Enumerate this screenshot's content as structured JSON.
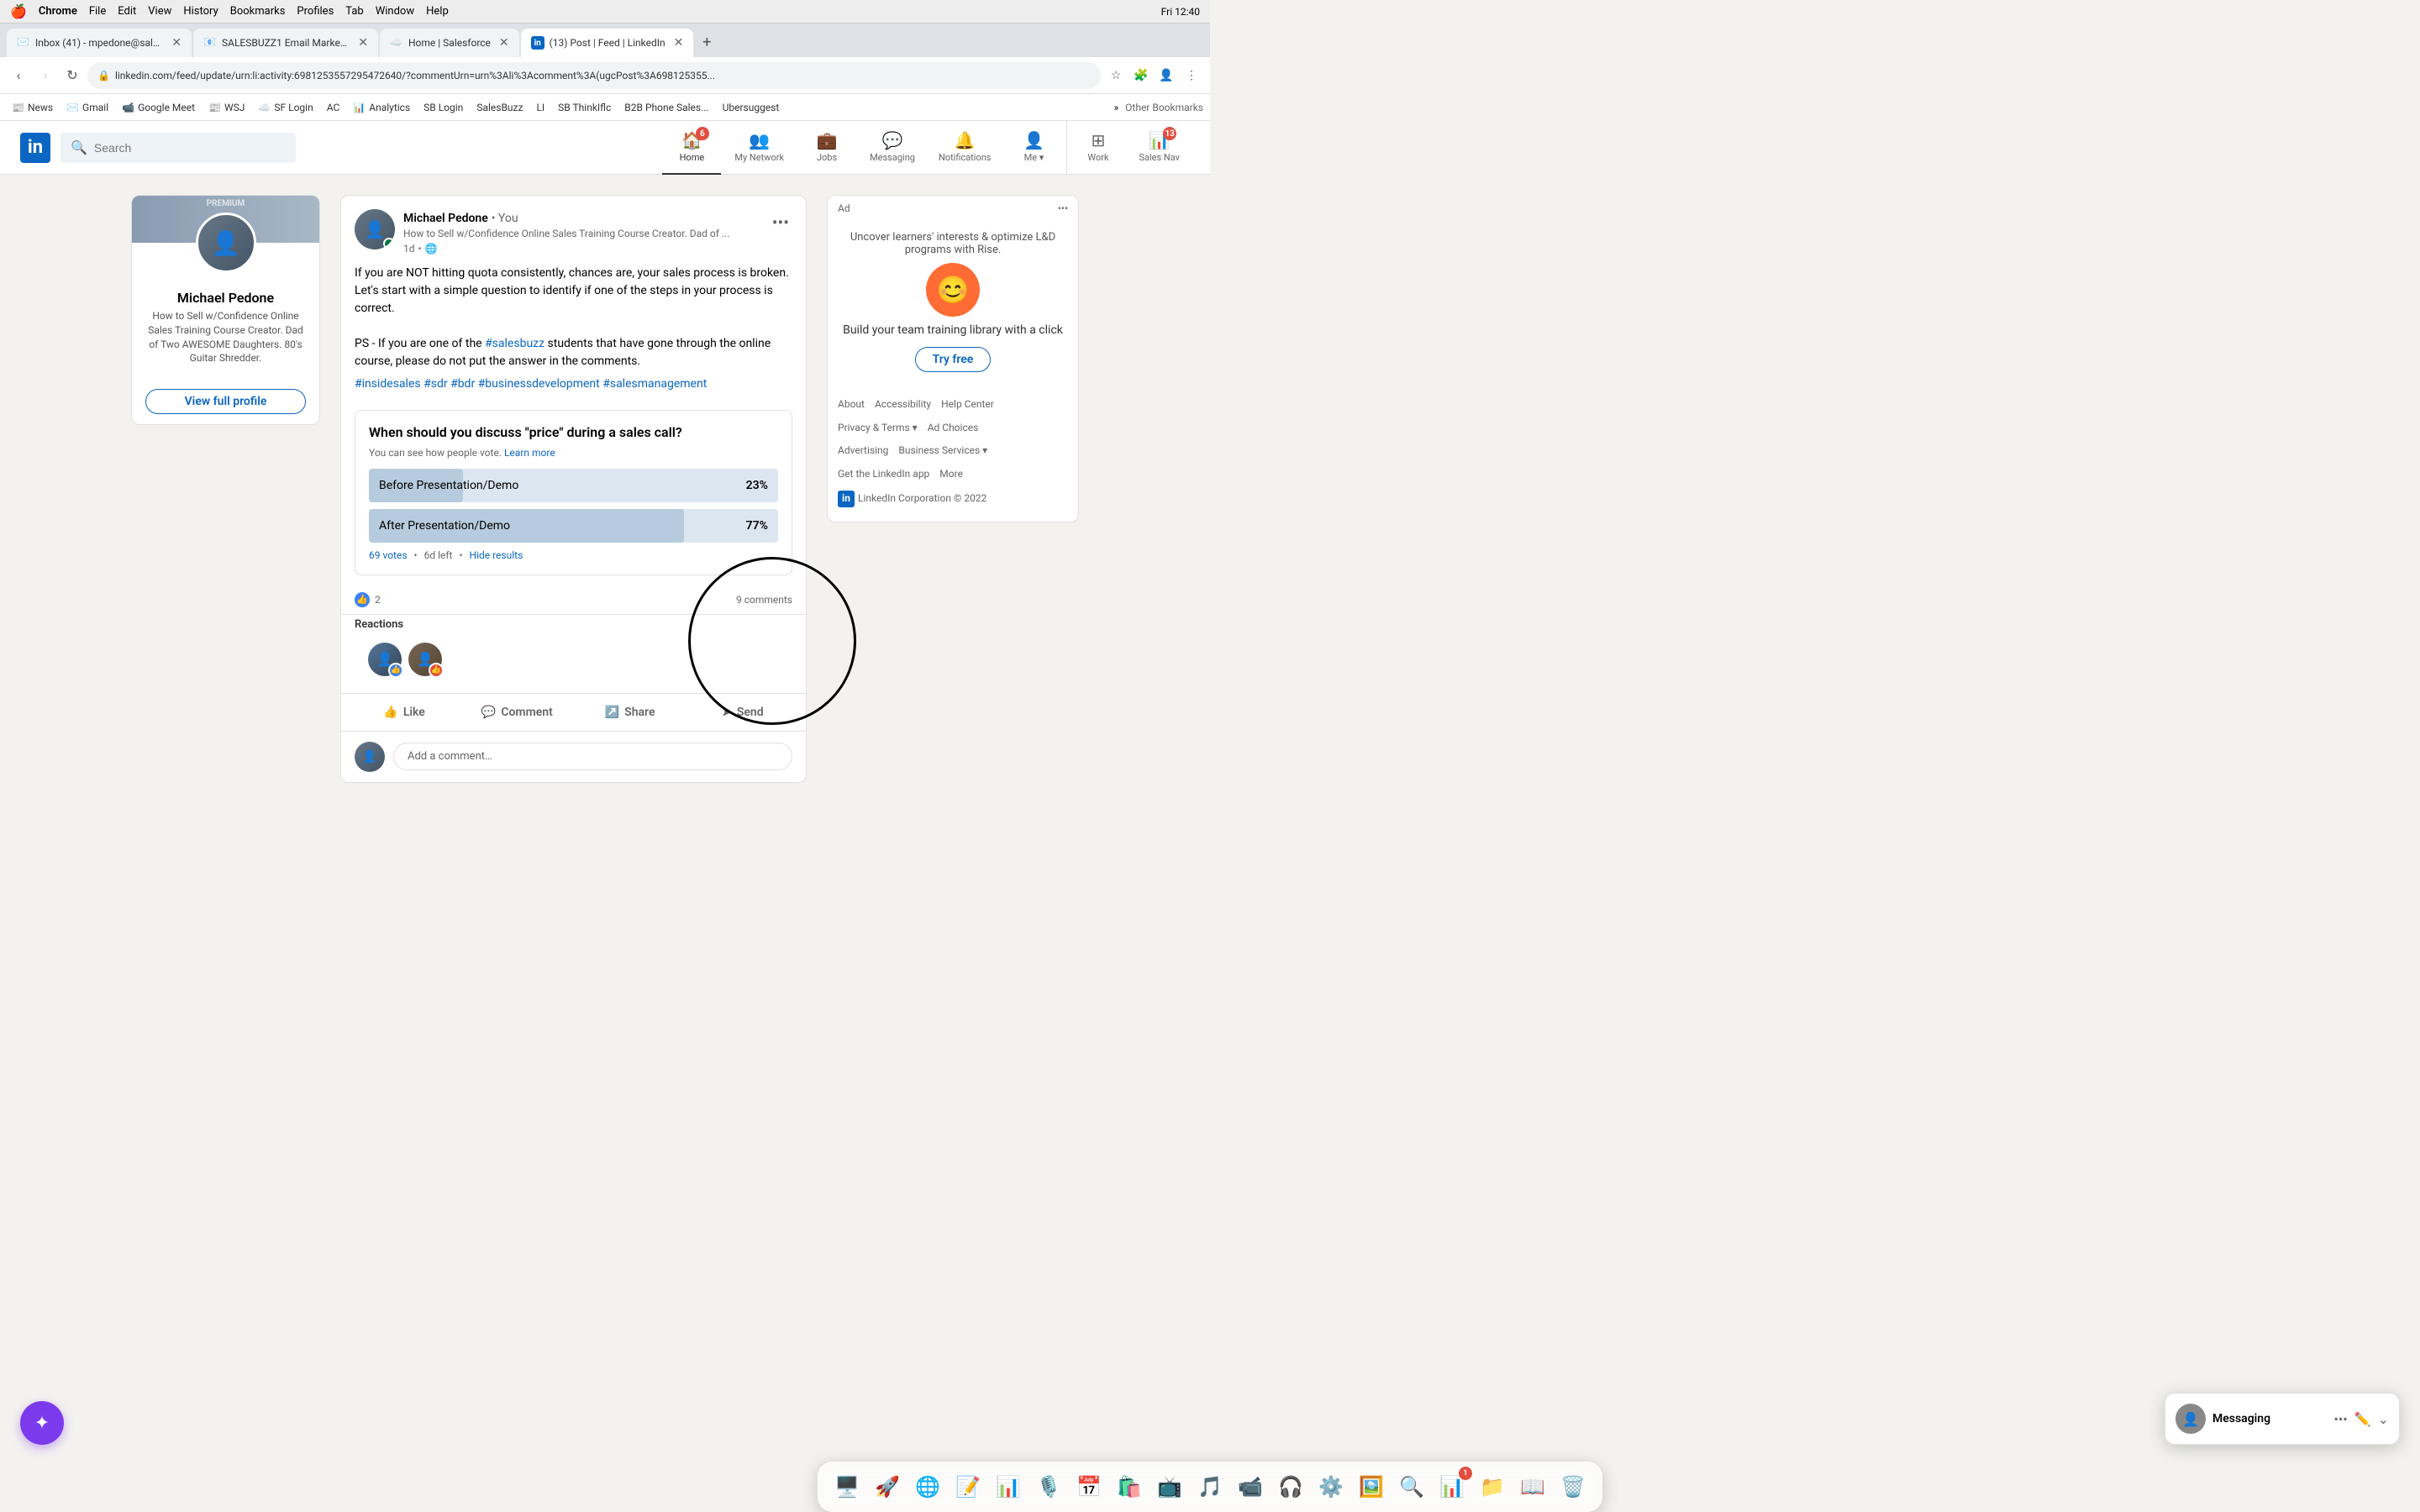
{
  "mac": {
    "menubar": {
      "apple": "🍎",
      "menus": [
        "Chrome",
        "File",
        "Edit",
        "View",
        "History",
        "Bookmarks",
        "Profiles",
        "Tab",
        "Window",
        "Help"
      ],
      "time": "Fri 12:40"
    }
  },
  "browser": {
    "tabs": [
      {
        "id": "tab1",
        "favicon": "✉️",
        "title": "Inbox (41) - mpedone@salesb...",
        "active": false
      },
      {
        "id": "tab2",
        "favicon": "📧",
        "title": "SALESBUZZ1 Email Marketing ...",
        "active": false
      },
      {
        "id": "tab3",
        "favicon": "☁️",
        "title": "Home | Salesforce",
        "active": false
      },
      {
        "id": "tab4",
        "favicon": "in",
        "title": "(13) Post | Feed | LinkedIn",
        "active": true
      }
    ],
    "url": "linkedin.com/feed/update/urn:li:activity:6981253557295472640/?commentUrn=urn%3Ali%3Acomment%3A(ugcPost%3A698125355...",
    "bookmarks": [
      {
        "label": "News",
        "icon": "📰"
      },
      {
        "label": "Gmail",
        "icon": "✉️"
      },
      {
        "label": "Google Meet",
        "icon": "📹"
      },
      {
        "label": "WSJ",
        "icon": "📰"
      },
      {
        "label": "SF Login",
        "icon": "☁️"
      },
      {
        "label": "AC",
        "icon": "🅰️"
      },
      {
        "label": "Analytics",
        "icon": "📊"
      },
      {
        "label": "SB Login",
        "icon": "🔐"
      },
      {
        "label": "SalesBuzz",
        "icon": "📞"
      },
      {
        "label": "LI",
        "icon": "in"
      },
      {
        "label": "SB ThinkIflc",
        "icon": "💡"
      },
      {
        "label": "B2B Phone Sales...",
        "icon": "📱"
      },
      {
        "label": "Ubersuggest",
        "icon": "🔍"
      }
    ]
  },
  "linkedin": {
    "nav": {
      "search_placeholder": "Search",
      "items": [
        {
          "id": "home",
          "label": "Home",
          "icon": "🏠",
          "active": true,
          "badge": null
        },
        {
          "id": "network",
          "label": "My Network",
          "icon": "👥",
          "active": false,
          "badge": null
        },
        {
          "id": "jobs",
          "label": "Jobs",
          "icon": "💼",
          "active": false,
          "badge": null
        },
        {
          "id": "messaging",
          "label": "Messaging",
          "icon": "💬",
          "active": false,
          "badge": null
        },
        {
          "id": "notifications",
          "label": "Notifications",
          "icon": "🔔",
          "active": false,
          "badge": null
        },
        {
          "id": "me",
          "label": "Me",
          "icon": "👤",
          "active": false,
          "badge": null
        },
        {
          "id": "work",
          "label": "Work",
          "icon": "⊞",
          "active": false,
          "badge": null
        },
        {
          "id": "sales",
          "label": "Sales Nav",
          "icon": "📊",
          "active": false,
          "badge": "13"
        }
      ]
    },
    "profile": {
      "name": "Michael Pedone",
      "headline": "How to Sell w/Confidence Online Sales Training Course Creator. Dad of Two AWESOME Daughters. 80's Guitar Shredder.",
      "view_profile_label": "View full profile"
    },
    "post": {
      "author": "Michael Pedone",
      "author_you": "• You",
      "author_headline": "How to Sell w/Confidence Online Sales Training Course Creator. Dad of ...",
      "time": "1d",
      "time_icon": "🌐",
      "more_icon": "•••",
      "body_p1": "If you are NOT hitting quota consistently, chances are, your sales process is broken. Let's start with a simple question to identify if one of the steps in your process is correct.",
      "body_p2": "PS - If you are one of the",
      "hashtag_salesbuzz": "#salesbuzz",
      "body_p2b": "students that have gone through the online course, please do not put the answer in the comments.",
      "hashtags": "#insidesales #sdr #bdr #businessdevelopment #salesmanagement",
      "poll": {
        "question": "When should you discuss \"price\" during a sales call?",
        "info": "You can see how people vote.",
        "learn_more": "Learn more",
        "options": [
          {
            "label": "Before Presentation/Demo",
            "pct": 23,
            "pct_label": "23%"
          },
          {
            "label": "After Presentation/Demo",
            "pct": 77,
            "pct_label": "77%"
          }
        ],
        "votes": "69 votes",
        "time_left": "6d left",
        "hide_results": "Hide results"
      },
      "reactions_count": "2",
      "comments_count": "9 comments",
      "reactions_label": "Reactions",
      "actions": [
        {
          "id": "like",
          "label": "Like",
          "icon": "👍"
        },
        {
          "id": "comment",
          "label": "Comment",
          "icon": "💬"
        },
        {
          "id": "share",
          "label": "Share",
          "icon": "↗️"
        },
        {
          "id": "send",
          "label": "Send",
          "icon": "➤"
        }
      ]
    },
    "ad": {
      "label": "Ad",
      "more_icon": "•••",
      "headline": "Uncover learners' interests & optimize L&D programs with Rise.",
      "logo_emoji": "😊",
      "subheadline": "Build your team training library with a click",
      "cta_label": "Try free"
    },
    "footer": {
      "links": [
        "About",
        "Accessibility",
        "Help Center",
        "Privacy & Terms",
        "Ad Choices",
        "Advertising",
        "Business Services",
        "Get the LinkedIn app",
        "More"
      ],
      "copyright": "LinkedIn Corporation © 2022"
    }
  },
  "messaging_widget": {
    "title": "Messaging",
    "avatar_emoji": "👤"
  },
  "dock": {
    "items": [
      {
        "id": "finder",
        "icon": "🖥️",
        "badge": null
      },
      {
        "id": "launchpad",
        "icon": "🚀",
        "badge": null
      },
      {
        "id": "chrome",
        "icon": "🌐",
        "badge": null
      },
      {
        "id": "word",
        "icon": "📝",
        "badge": null
      },
      {
        "id": "excel",
        "icon": "📊",
        "badge": null
      },
      {
        "id": "podcasts",
        "icon": "🎙️",
        "badge": null
      },
      {
        "id": "calendar",
        "icon": "📅",
        "badge": null
      },
      {
        "id": "appstore",
        "icon": "🛍️",
        "badge": null
      },
      {
        "id": "tvapp",
        "icon": "📺",
        "badge": null
      },
      {
        "id": "spotify",
        "icon": "🎵",
        "badge": null
      },
      {
        "id": "zoom",
        "icon": "📹",
        "badge": null
      },
      {
        "id": "rodecaster",
        "icon": "🎧",
        "badge": null
      },
      {
        "id": "settings",
        "icon": "⚙️",
        "badge": null
      },
      {
        "id": "photos",
        "icon": "🖼️",
        "badge": null
      },
      {
        "id": "lens",
        "icon": "🔍",
        "badge": null
      },
      {
        "id": "powerpoint",
        "icon": "📊",
        "badge": null
      },
      {
        "id": "finder2",
        "icon": "📁",
        "badge": null
      },
      {
        "id": "dict",
        "icon": "📖",
        "badge": null
      },
      {
        "id": "trash",
        "icon": "🗑️",
        "badge": null
      }
    ]
  },
  "spotlight": {
    "icon": "✦"
  }
}
